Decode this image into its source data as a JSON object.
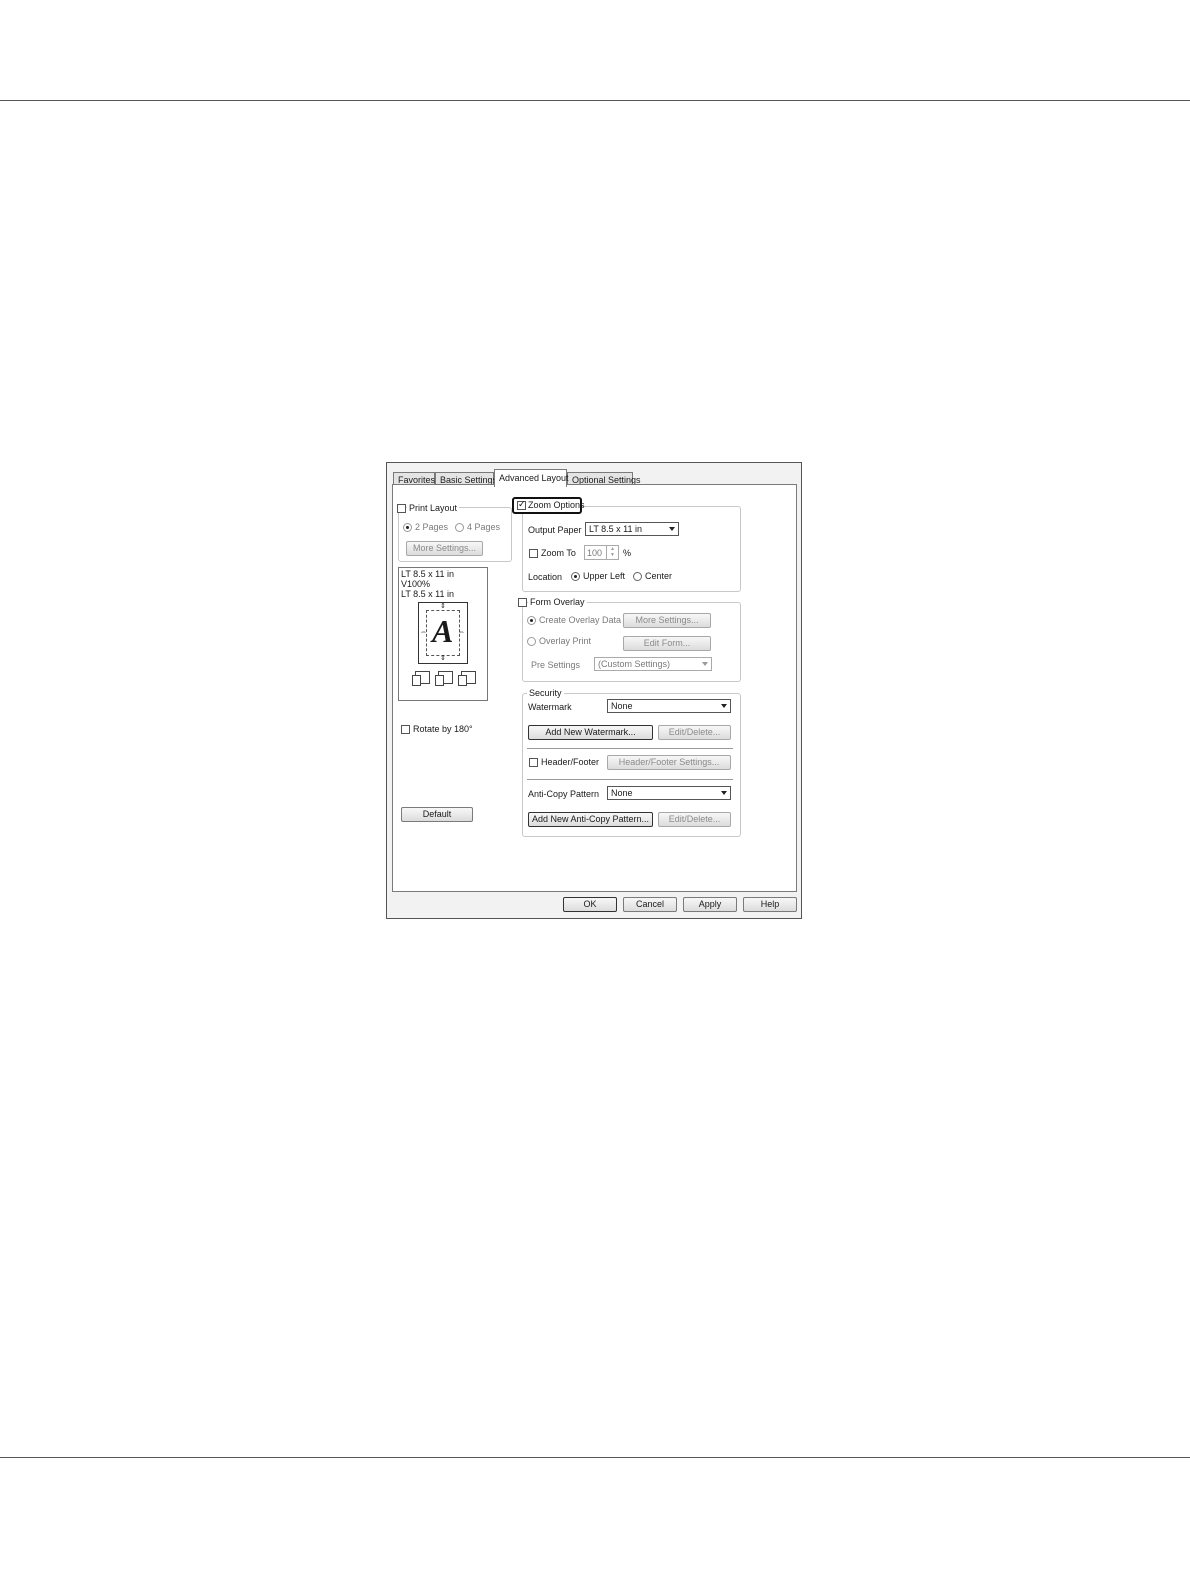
{
  "tabs": [
    "Favorites",
    "Basic Settings",
    "Advanced Layout",
    "Optional Settings"
  ],
  "print_layout": {
    "label": "Print Layout",
    "checked": false,
    "option_2pages": "2 Pages",
    "option_4pages": "4 Pages",
    "more_settings": "More Settings..."
  },
  "preview": {
    "line1": "LT 8.5 x 11 in",
    "line2": "V100%",
    "line3": "LT 8.5 x 11 in",
    "glyph": "A"
  },
  "rotate": {
    "label": "Rotate by 180°",
    "checked": false
  },
  "default_button": "Default",
  "zoom": {
    "label": "Zoom Options",
    "checked": true,
    "output_paper_label": "Output Paper",
    "output_paper_value": "LT 8.5 x 11 in",
    "zoom_to_label": "Zoom To",
    "zoom_value": "100",
    "percent": "%",
    "location_label": "Location",
    "upper_left": "Upper Left",
    "center": "Center"
  },
  "form_overlay": {
    "label": "Form Overlay",
    "create_overlay": "Create Overlay Data",
    "more_settings": "More Settings...",
    "overlay_print": "Overlay Print",
    "edit_form": "Edit Form...",
    "pre_settings_label": "Pre Settings",
    "pre_settings_value": "(Custom Settings)"
  },
  "security": {
    "label": "Security",
    "watermark_label": "Watermark",
    "watermark_value": "None",
    "add_watermark": "Add New Watermark...",
    "edit_delete_1": "Edit/Delete...",
    "header_footer_label": "Header/Footer",
    "header_footer_settings": "Header/Footer Settings...",
    "anticopy_label": "Anti-Copy Pattern",
    "anticopy_value": "None",
    "add_anticopy": "Add New Anti-Copy Pattern...",
    "edit_delete_2": "Edit/Delete..."
  },
  "footer_buttons": {
    "ok": "OK",
    "cancel": "Cancel",
    "apply": "Apply",
    "help": "Help"
  }
}
